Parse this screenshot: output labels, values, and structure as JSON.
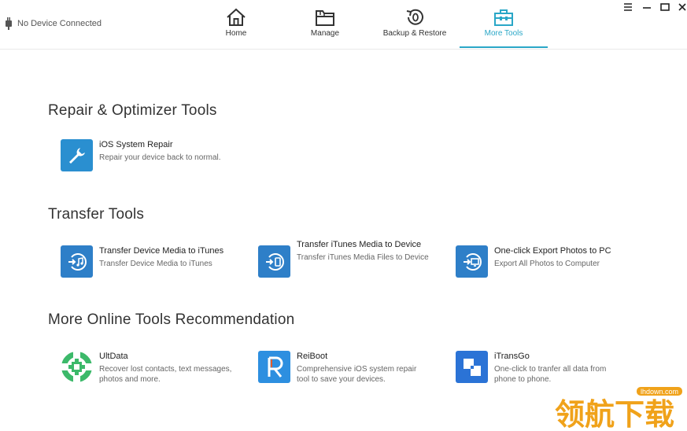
{
  "header": {
    "device_status": "No Device Connected",
    "tabs": [
      {
        "label": "Home",
        "icon": "home-icon"
      },
      {
        "label": "Manage",
        "icon": "folder-icon"
      },
      {
        "label": "Backup & Restore",
        "icon": "backup-restore-icon"
      },
      {
        "label": "More Tools",
        "icon": "toolbox-icon",
        "active": true
      }
    ],
    "accent_color": "#2aa7c7"
  },
  "sections": {
    "repair": {
      "title": "Repair & Optimizer Tools",
      "items": [
        {
          "name": "iOS System Repair",
          "desc": "Repair your device back to normal.",
          "icon": "wrench-icon"
        }
      ]
    },
    "transfer": {
      "title": "Transfer Tools",
      "items": [
        {
          "name": "Transfer Device Media to iTunes",
          "desc": "Transfer Device Media to iTunes",
          "icon": "transfer-music-icon"
        },
        {
          "name": "Transfer iTunes Media to Device",
          "desc": "Transfer iTunes Media Files to Device",
          "icon": "transfer-device-icon"
        },
        {
          "name": "One-click Export Photos to PC",
          "desc": "Export All Photos to Computer",
          "icon": "export-pc-icon"
        }
      ]
    },
    "online": {
      "title": "More Online Tools Recommendation",
      "items": [
        {
          "name": "UltData",
          "desc": "Recover lost contacts, text messages, photos and more.",
          "icon": "ultdata-icon"
        },
        {
          "name": "ReiBoot",
          "desc": "Comprehensive iOS system repair tool to save your devices.",
          "icon": "reiboot-icon"
        },
        {
          "name": "iTransGo",
          "desc": "One-click to tranfer all data from phone to phone.",
          "icon": "itransgo-icon"
        }
      ]
    }
  },
  "watermark": {
    "text": "领航下载",
    "url": "lhdown.com"
  }
}
